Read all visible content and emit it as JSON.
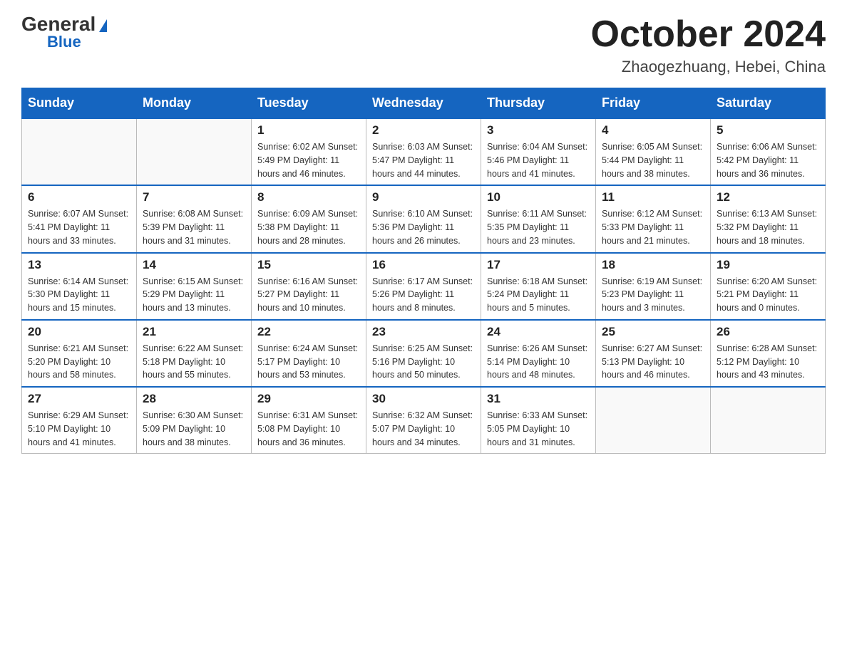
{
  "header": {
    "logo": {
      "general": "General",
      "blue": "Blue",
      "triangle": "▼"
    },
    "title": "October 2024",
    "location": "Zhaogezhuang, Hebei, China"
  },
  "calendar": {
    "days_of_week": [
      "Sunday",
      "Monday",
      "Tuesday",
      "Wednesday",
      "Thursday",
      "Friday",
      "Saturday"
    ],
    "weeks": [
      [
        {
          "day": "",
          "info": ""
        },
        {
          "day": "",
          "info": ""
        },
        {
          "day": "1",
          "info": "Sunrise: 6:02 AM\nSunset: 5:49 PM\nDaylight: 11 hours\nand 46 minutes."
        },
        {
          "day": "2",
          "info": "Sunrise: 6:03 AM\nSunset: 5:47 PM\nDaylight: 11 hours\nand 44 minutes."
        },
        {
          "day": "3",
          "info": "Sunrise: 6:04 AM\nSunset: 5:46 PM\nDaylight: 11 hours\nand 41 minutes."
        },
        {
          "day": "4",
          "info": "Sunrise: 6:05 AM\nSunset: 5:44 PM\nDaylight: 11 hours\nand 38 minutes."
        },
        {
          "day": "5",
          "info": "Sunrise: 6:06 AM\nSunset: 5:42 PM\nDaylight: 11 hours\nand 36 minutes."
        }
      ],
      [
        {
          "day": "6",
          "info": "Sunrise: 6:07 AM\nSunset: 5:41 PM\nDaylight: 11 hours\nand 33 minutes."
        },
        {
          "day": "7",
          "info": "Sunrise: 6:08 AM\nSunset: 5:39 PM\nDaylight: 11 hours\nand 31 minutes."
        },
        {
          "day": "8",
          "info": "Sunrise: 6:09 AM\nSunset: 5:38 PM\nDaylight: 11 hours\nand 28 minutes."
        },
        {
          "day": "9",
          "info": "Sunrise: 6:10 AM\nSunset: 5:36 PM\nDaylight: 11 hours\nand 26 minutes."
        },
        {
          "day": "10",
          "info": "Sunrise: 6:11 AM\nSunset: 5:35 PM\nDaylight: 11 hours\nand 23 minutes."
        },
        {
          "day": "11",
          "info": "Sunrise: 6:12 AM\nSunset: 5:33 PM\nDaylight: 11 hours\nand 21 minutes."
        },
        {
          "day": "12",
          "info": "Sunrise: 6:13 AM\nSunset: 5:32 PM\nDaylight: 11 hours\nand 18 minutes."
        }
      ],
      [
        {
          "day": "13",
          "info": "Sunrise: 6:14 AM\nSunset: 5:30 PM\nDaylight: 11 hours\nand 15 minutes."
        },
        {
          "day": "14",
          "info": "Sunrise: 6:15 AM\nSunset: 5:29 PM\nDaylight: 11 hours\nand 13 minutes."
        },
        {
          "day": "15",
          "info": "Sunrise: 6:16 AM\nSunset: 5:27 PM\nDaylight: 11 hours\nand 10 minutes."
        },
        {
          "day": "16",
          "info": "Sunrise: 6:17 AM\nSunset: 5:26 PM\nDaylight: 11 hours\nand 8 minutes."
        },
        {
          "day": "17",
          "info": "Sunrise: 6:18 AM\nSunset: 5:24 PM\nDaylight: 11 hours\nand 5 minutes."
        },
        {
          "day": "18",
          "info": "Sunrise: 6:19 AM\nSunset: 5:23 PM\nDaylight: 11 hours\nand 3 minutes."
        },
        {
          "day": "19",
          "info": "Sunrise: 6:20 AM\nSunset: 5:21 PM\nDaylight: 11 hours\nand 0 minutes."
        }
      ],
      [
        {
          "day": "20",
          "info": "Sunrise: 6:21 AM\nSunset: 5:20 PM\nDaylight: 10 hours\nand 58 minutes."
        },
        {
          "day": "21",
          "info": "Sunrise: 6:22 AM\nSunset: 5:18 PM\nDaylight: 10 hours\nand 55 minutes."
        },
        {
          "day": "22",
          "info": "Sunrise: 6:24 AM\nSunset: 5:17 PM\nDaylight: 10 hours\nand 53 minutes."
        },
        {
          "day": "23",
          "info": "Sunrise: 6:25 AM\nSunset: 5:16 PM\nDaylight: 10 hours\nand 50 minutes."
        },
        {
          "day": "24",
          "info": "Sunrise: 6:26 AM\nSunset: 5:14 PM\nDaylight: 10 hours\nand 48 minutes."
        },
        {
          "day": "25",
          "info": "Sunrise: 6:27 AM\nSunset: 5:13 PM\nDaylight: 10 hours\nand 46 minutes."
        },
        {
          "day": "26",
          "info": "Sunrise: 6:28 AM\nSunset: 5:12 PM\nDaylight: 10 hours\nand 43 minutes."
        }
      ],
      [
        {
          "day": "27",
          "info": "Sunrise: 6:29 AM\nSunset: 5:10 PM\nDaylight: 10 hours\nand 41 minutes."
        },
        {
          "day": "28",
          "info": "Sunrise: 6:30 AM\nSunset: 5:09 PM\nDaylight: 10 hours\nand 38 minutes."
        },
        {
          "day": "29",
          "info": "Sunrise: 6:31 AM\nSunset: 5:08 PM\nDaylight: 10 hours\nand 36 minutes."
        },
        {
          "day": "30",
          "info": "Sunrise: 6:32 AM\nSunset: 5:07 PM\nDaylight: 10 hours\nand 34 minutes."
        },
        {
          "day": "31",
          "info": "Sunrise: 6:33 AM\nSunset: 5:05 PM\nDaylight: 10 hours\nand 31 minutes."
        },
        {
          "day": "",
          "info": ""
        },
        {
          "day": "",
          "info": ""
        }
      ]
    ]
  }
}
